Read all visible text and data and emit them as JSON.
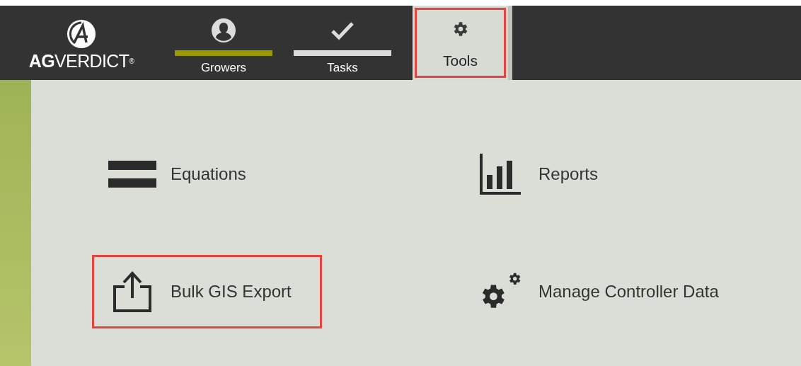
{
  "logo": {
    "text_bold": "AG",
    "text_light": "VERDICT",
    "mark": "®"
  },
  "tabs": [
    {
      "label": "Growers",
      "kind": "person",
      "selected": false,
      "highlighted": false,
      "color": "#9a9a00"
    },
    {
      "label": "Tasks",
      "kind": "check",
      "selected": false,
      "highlighted": false,
      "color": "#dcdcdc"
    },
    {
      "label": "Tools",
      "kind": "gear",
      "selected": true,
      "highlighted": true
    }
  ],
  "tools": [
    {
      "label": "Equations",
      "kind": "equals",
      "highlighted": false
    },
    {
      "label": "Reports",
      "kind": "chart",
      "highlighted": false
    },
    {
      "label": "Bulk GIS Export",
      "kind": "export",
      "highlighted": true
    },
    {
      "label": "Manage Controller Data",
      "kind": "gears",
      "highlighted": false
    }
  ]
}
